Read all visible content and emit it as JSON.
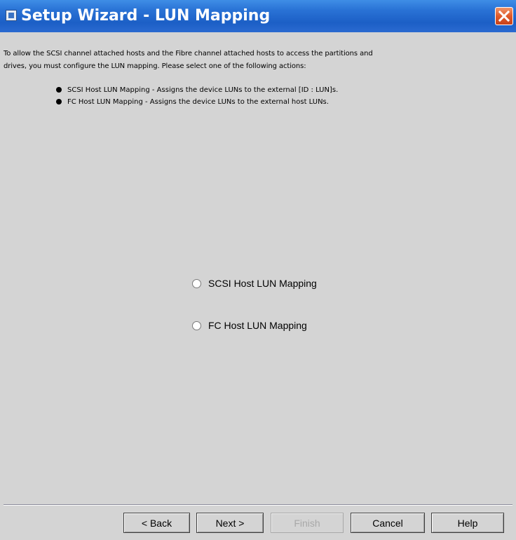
{
  "window": {
    "title": "Setup Wizard - LUN Mapping"
  },
  "content": {
    "intro_line1": "To allow the SCSI channel attached hosts and the Fibre channel attached hosts to access the partitions and",
    "intro_line2": "drives, you must configure the LUN mapping. Please select one of the following actions:",
    "bullets": [
      {
        "text": "SCSI Host LUN Mapping - Assigns the device LUNs to the external [ID : LUN]s."
      },
      {
        "text": "FC Host LUN Mapping - Assigns the device LUNs to the external host LUNs."
      }
    ],
    "options": [
      {
        "label": "SCSI Host LUN Mapping",
        "selected": false
      },
      {
        "label": "FC Host LUN Mapping",
        "selected": false
      }
    ]
  },
  "buttons": {
    "back": "< Back",
    "next": "Next >",
    "finish": "Finish",
    "cancel": "Cancel",
    "help": "Help"
  },
  "colors": {
    "titlebar": "#2a6ad0",
    "background": "#d4d4d4",
    "close": "#e05a2a"
  },
  "icons": {
    "app": "app-window-icon",
    "close": "close-icon"
  }
}
